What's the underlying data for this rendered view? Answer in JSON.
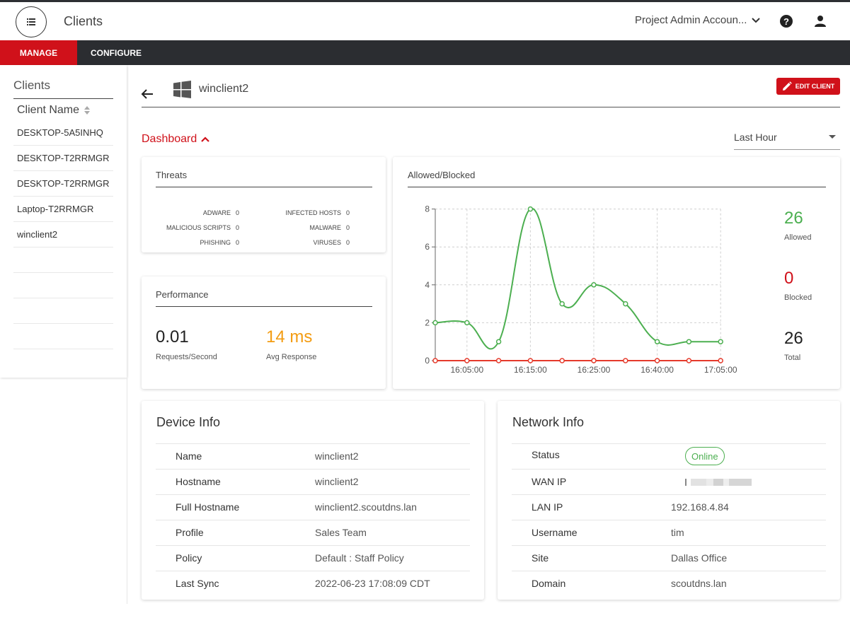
{
  "header": {
    "title": "Clients",
    "account": "Project Admin Accoun...",
    "menu_icon": "list-icon",
    "help_icon": "help-icon",
    "user_icon": "user-icon"
  },
  "nav": {
    "manage": "MANAGE",
    "configure": "CONFIGURE"
  },
  "sidebar": {
    "title": "Clients",
    "column_header": "Client Name",
    "items": [
      "DESKTOP-5A5INHQ",
      "DESKTOP-T2RRMGR",
      "DESKTOP-T2RRMGR",
      "Laptop-T2RRMGR",
      "winclient2"
    ]
  },
  "client": {
    "name": "winclient2",
    "os_icon": "windows-icon",
    "edit_label": "EDIT CLIENT"
  },
  "dashboard": {
    "toggle_label": "Dashboard",
    "range": "Last Hour"
  },
  "threats": {
    "title": "Threats",
    "left": [
      {
        "label": "ADWARE",
        "value": "0"
      },
      {
        "label": "MALICIOUS SCRIPTS",
        "value": "0"
      },
      {
        "label": "PHISHING",
        "value": "0"
      }
    ],
    "right": [
      {
        "label": "INFECTED HOSTS",
        "value": "0"
      },
      {
        "label": "MALWARE",
        "value": "0"
      },
      {
        "label": "VIRUSES",
        "value": "0"
      }
    ]
  },
  "performance": {
    "title": "Performance",
    "requests_value": "0.01",
    "requests_label": "Requests/Second",
    "response_value": "14 ms",
    "response_label": "Avg Response"
  },
  "allowed_blocked": {
    "title": "Allowed/Blocked",
    "allowed_value": "26",
    "allowed_label": "Allowed",
    "blocked_value": "0",
    "blocked_label": "Blocked",
    "total_value": "26",
    "total_label": "Total"
  },
  "chart_data": {
    "type": "line",
    "x_tick_labels": [
      "16:05:00",
      "16:15:00",
      "16:25:00",
      "16:40:00",
      "17:05:00"
    ],
    "ylim": [
      0,
      8
    ],
    "y_ticks": [
      0,
      2,
      4,
      6,
      8
    ],
    "grid": true,
    "series": [
      {
        "color": "#4caf50",
        "values": [
          2,
          2,
          1,
          8,
          3,
          4,
          3,
          1,
          1,
          1
        ]
      },
      {
        "color": "#e53a2b",
        "values": [
          0,
          0,
          0,
          0,
          0,
          0,
          0,
          0,
          0,
          0
        ]
      }
    ],
    "x_ticks_at_index": [
      1,
      3,
      5,
      7,
      9
    ]
  },
  "device_info": {
    "title": "Device Info",
    "rows": [
      {
        "key": "Name",
        "value": "winclient2"
      },
      {
        "key": "Hostname",
        "value": "winclient2"
      },
      {
        "key": "Full Hostname",
        "value": "winclient2.scoutdns.lan"
      },
      {
        "key": "Profile",
        "value": "Sales Team"
      },
      {
        "key": "Policy",
        "value": "Default : Staff Policy"
      },
      {
        "key": "Last Sync",
        "value": "2022-06-23 17:08:09 CDT"
      }
    ]
  },
  "network_info": {
    "title": "Network Info",
    "status_key": "Status",
    "status_value": "Online",
    "wan_key": "WAN IP",
    "rows": [
      {
        "key": "LAN IP",
        "value": "192.168.4.84"
      },
      {
        "key": "Username",
        "value": "tim"
      },
      {
        "key": "Site",
        "value": "Dallas Office"
      },
      {
        "key": "Domain",
        "value": "scoutdns.lan"
      }
    ]
  },
  "colors": {
    "accent": "#d0111a",
    "allowed": "#4caf50",
    "blocked": "#d0111a",
    "response": "#f39c12",
    "navbar": "#2b2d31"
  }
}
